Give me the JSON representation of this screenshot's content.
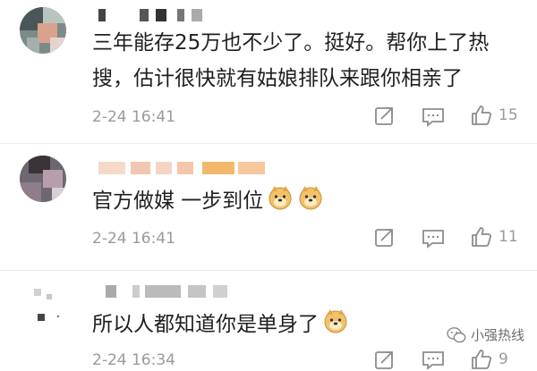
{
  "comments": [
    {
      "text_lines": [
        "三年能存25万也不少了。挺好。帮你上了热",
        "搜，估计很快就有姑娘排队来跟你相亲了"
      ],
      "time": "2-24 16:41",
      "likes": "15"
    },
    {
      "text_lines": [
        "官方做媒 一步到位"
      ],
      "emoji_count": 2,
      "time": "2-24 16:41",
      "likes": "11"
    },
    {
      "text_lines": [
        "所以人都知道你是单身了"
      ],
      "emoji_count": 1,
      "time": "2-24 16:34",
      "likes": "9"
    }
  ],
  "icons": {
    "repost": "share-arrow-icon",
    "reply": "comment-bubble-icon",
    "like": "thumbs-up-icon",
    "emoji": "doge-emoji-icon"
  },
  "watermark": {
    "text": "小强热线"
  },
  "colors": {
    "text": "#1f1f1f",
    "meta": "#9a9a9a",
    "icon": "#8c8c8c",
    "divider": "#ececec"
  }
}
